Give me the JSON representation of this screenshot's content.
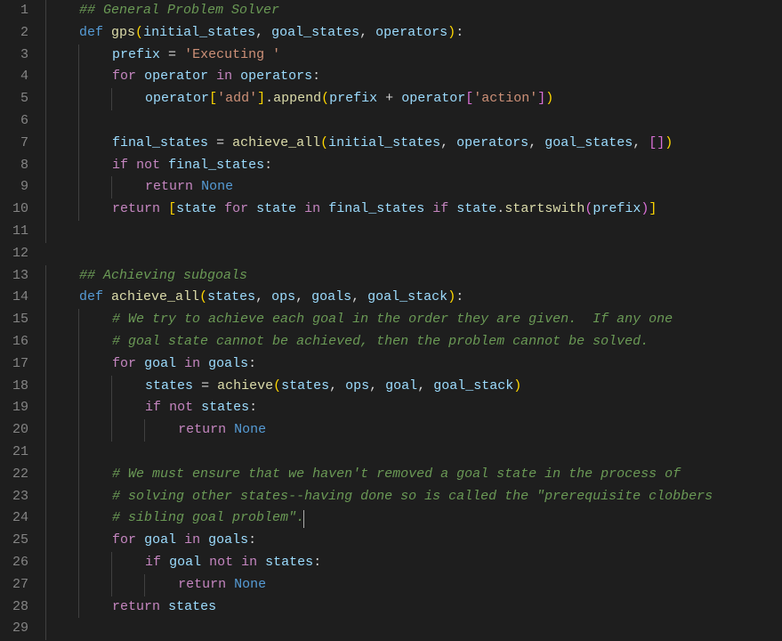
{
  "colors": {
    "background": "#1e1e1e",
    "gutter": "#858585",
    "comment": "#6a9955",
    "keyword": "#c586c0",
    "constant": "#569cd6",
    "function": "#dcdcaa",
    "string": "#ce9178",
    "variable": "#9cdcfe",
    "punctuation": "#d4d4d4",
    "bracket1": "#ffd700",
    "bracket2": "#da70d6",
    "bracket3": "#179fff",
    "cursor": "#aeafad",
    "indentGuide": "#404040"
  },
  "cursorLine": 24,
  "lines": [
    {
      "num": 1,
      "indent": 1,
      "tokens": [
        [
          "comment",
          "## General Problem Solver"
        ]
      ]
    },
    {
      "num": 2,
      "indent": 1,
      "tokens": [
        [
          "def",
          "def "
        ],
        [
          "func",
          "gps"
        ],
        [
          "bracket",
          "("
        ],
        [
          "var",
          "initial_states"
        ],
        [
          "punc",
          ", "
        ],
        [
          "var",
          "goal_states"
        ],
        [
          "punc",
          ", "
        ],
        [
          "var",
          "operators"
        ],
        [
          "bracket",
          ")"
        ],
        [
          "punc",
          ":"
        ]
      ]
    },
    {
      "num": 3,
      "indent": 2,
      "tokens": [
        [
          "var",
          "prefix"
        ],
        [
          "op",
          " = "
        ],
        [
          "string",
          "'Executing '"
        ]
      ]
    },
    {
      "num": 4,
      "indent": 2,
      "tokens": [
        [
          "keyword",
          "for"
        ],
        [
          "punc",
          " "
        ],
        [
          "var",
          "operator"
        ],
        [
          "punc",
          " "
        ],
        [
          "keyword",
          "in"
        ],
        [
          "punc",
          " "
        ],
        [
          "var",
          "operators"
        ],
        [
          "punc",
          ":"
        ]
      ]
    },
    {
      "num": 5,
      "indent": 3,
      "tokens": [
        [
          "var",
          "operator"
        ],
        [
          "bracket",
          "["
        ],
        [
          "string",
          "'add'"
        ],
        [
          "bracket",
          "]"
        ],
        [
          "punc",
          "."
        ],
        [
          "func",
          "append"
        ],
        [
          "bracket",
          "("
        ],
        [
          "var",
          "prefix"
        ],
        [
          "op",
          " + "
        ],
        [
          "var",
          "operator"
        ],
        [
          "bracket2",
          "["
        ],
        [
          "string",
          "'action'"
        ],
        [
          "bracket2",
          "]"
        ],
        [
          "bracket",
          ")"
        ]
      ]
    },
    {
      "num": 6,
      "indent": 2,
      "tokens": []
    },
    {
      "num": 7,
      "indent": 2,
      "tokens": [
        [
          "var",
          "final_states"
        ],
        [
          "op",
          " = "
        ],
        [
          "func",
          "achieve_all"
        ],
        [
          "bracket",
          "("
        ],
        [
          "var",
          "initial_states"
        ],
        [
          "punc",
          ", "
        ],
        [
          "var",
          "operators"
        ],
        [
          "punc",
          ", "
        ],
        [
          "var",
          "goal_states"
        ],
        [
          "punc",
          ", "
        ],
        [
          "bracket2",
          "["
        ],
        [
          "bracket2",
          "]"
        ],
        [
          "bracket",
          ")"
        ]
      ]
    },
    {
      "num": 8,
      "indent": 2,
      "tokens": [
        [
          "keyword",
          "if"
        ],
        [
          "punc",
          " "
        ],
        [
          "keyword",
          "not"
        ],
        [
          "punc",
          " "
        ],
        [
          "var",
          "final_states"
        ],
        [
          "punc",
          ":"
        ]
      ]
    },
    {
      "num": 9,
      "indent": 3,
      "tokens": [
        [
          "keyword",
          "return"
        ],
        [
          "punc",
          " "
        ],
        [
          "const",
          "None"
        ]
      ]
    },
    {
      "num": 10,
      "indent": 2,
      "tokens": [
        [
          "keyword",
          "return"
        ],
        [
          "punc",
          " "
        ],
        [
          "bracket",
          "["
        ],
        [
          "var",
          "state"
        ],
        [
          "punc",
          " "
        ],
        [
          "keyword",
          "for"
        ],
        [
          "punc",
          " "
        ],
        [
          "var",
          "state"
        ],
        [
          "punc",
          " "
        ],
        [
          "keyword",
          "in"
        ],
        [
          "punc",
          " "
        ],
        [
          "var",
          "final_states"
        ],
        [
          "punc",
          " "
        ],
        [
          "keyword",
          "if"
        ],
        [
          "punc",
          " "
        ],
        [
          "var",
          "state"
        ],
        [
          "punc",
          "."
        ],
        [
          "func",
          "startswith"
        ],
        [
          "bracket2",
          "("
        ],
        [
          "var",
          "prefix"
        ],
        [
          "bracket2",
          ")"
        ],
        [
          "bracket",
          "]"
        ]
      ]
    },
    {
      "num": 11,
      "indent": 1,
      "tokens": []
    },
    {
      "num": 12,
      "indent": 0,
      "tokens": []
    },
    {
      "num": 13,
      "indent": 1,
      "tokens": [
        [
          "comment",
          "## Achieving subgoals"
        ]
      ]
    },
    {
      "num": 14,
      "indent": 1,
      "tokens": [
        [
          "def",
          "def "
        ],
        [
          "func",
          "achieve_all"
        ],
        [
          "bracket",
          "("
        ],
        [
          "var",
          "states"
        ],
        [
          "punc",
          ", "
        ],
        [
          "var",
          "ops"
        ],
        [
          "punc",
          ", "
        ],
        [
          "var",
          "goals"
        ],
        [
          "punc",
          ", "
        ],
        [
          "var",
          "goal_stack"
        ],
        [
          "bracket",
          ")"
        ],
        [
          "punc",
          ":"
        ]
      ]
    },
    {
      "num": 15,
      "indent": 2,
      "tokens": [
        [
          "comment",
          "# We try to achieve each goal in the order they are given.  If any one"
        ]
      ]
    },
    {
      "num": 16,
      "indent": 2,
      "tokens": [
        [
          "comment",
          "# goal state cannot be achieved, then the problem cannot be solved."
        ]
      ]
    },
    {
      "num": 17,
      "indent": 2,
      "tokens": [
        [
          "keyword",
          "for"
        ],
        [
          "punc",
          " "
        ],
        [
          "var",
          "goal"
        ],
        [
          "punc",
          " "
        ],
        [
          "keyword",
          "in"
        ],
        [
          "punc",
          " "
        ],
        [
          "var",
          "goals"
        ],
        [
          "punc",
          ":"
        ]
      ]
    },
    {
      "num": 18,
      "indent": 3,
      "tokens": [
        [
          "var",
          "states"
        ],
        [
          "op",
          " = "
        ],
        [
          "func",
          "achieve"
        ],
        [
          "bracket",
          "("
        ],
        [
          "var",
          "states"
        ],
        [
          "punc",
          ", "
        ],
        [
          "var",
          "ops"
        ],
        [
          "punc",
          ", "
        ],
        [
          "var",
          "goal"
        ],
        [
          "punc",
          ", "
        ],
        [
          "var",
          "goal_stack"
        ],
        [
          "bracket",
          ")"
        ]
      ]
    },
    {
      "num": 19,
      "indent": 3,
      "tokens": [
        [
          "keyword",
          "if"
        ],
        [
          "punc",
          " "
        ],
        [
          "keyword",
          "not"
        ],
        [
          "punc",
          " "
        ],
        [
          "var",
          "states"
        ],
        [
          "punc",
          ":"
        ]
      ]
    },
    {
      "num": 20,
      "indent": 4,
      "tokens": [
        [
          "keyword",
          "return"
        ],
        [
          "punc",
          " "
        ],
        [
          "const",
          "None"
        ]
      ]
    },
    {
      "num": 21,
      "indent": 2,
      "tokens": []
    },
    {
      "num": 22,
      "indent": 2,
      "tokens": [
        [
          "comment",
          "# We must ensure that we haven't removed a goal state in the process of"
        ]
      ]
    },
    {
      "num": 23,
      "indent": 2,
      "tokens": [
        [
          "comment",
          "# solving other states--having done so is called the \"prerequisite clobbers"
        ]
      ]
    },
    {
      "num": 24,
      "indent": 2,
      "tokens": [
        [
          "comment",
          "# sibling goal problem\"."
        ]
      ],
      "cursorAfter": true
    },
    {
      "num": 25,
      "indent": 2,
      "tokens": [
        [
          "keyword",
          "for"
        ],
        [
          "punc",
          " "
        ],
        [
          "var",
          "goal"
        ],
        [
          "punc",
          " "
        ],
        [
          "keyword",
          "in"
        ],
        [
          "punc",
          " "
        ],
        [
          "var",
          "goals"
        ],
        [
          "punc",
          ":"
        ]
      ]
    },
    {
      "num": 26,
      "indent": 3,
      "tokens": [
        [
          "keyword",
          "if"
        ],
        [
          "punc",
          " "
        ],
        [
          "var",
          "goal"
        ],
        [
          "punc",
          " "
        ],
        [
          "keyword",
          "not"
        ],
        [
          "punc",
          " "
        ],
        [
          "keyword",
          "in"
        ],
        [
          "punc",
          " "
        ],
        [
          "var",
          "states"
        ],
        [
          "punc",
          ":"
        ]
      ]
    },
    {
      "num": 27,
      "indent": 4,
      "tokens": [
        [
          "keyword",
          "return"
        ],
        [
          "punc",
          " "
        ],
        [
          "const",
          "None"
        ]
      ]
    },
    {
      "num": 28,
      "indent": 2,
      "tokens": [
        [
          "keyword",
          "return"
        ],
        [
          "punc",
          " "
        ],
        [
          "var",
          "states"
        ]
      ]
    },
    {
      "num": 29,
      "indent": 1,
      "tokens": []
    }
  ]
}
